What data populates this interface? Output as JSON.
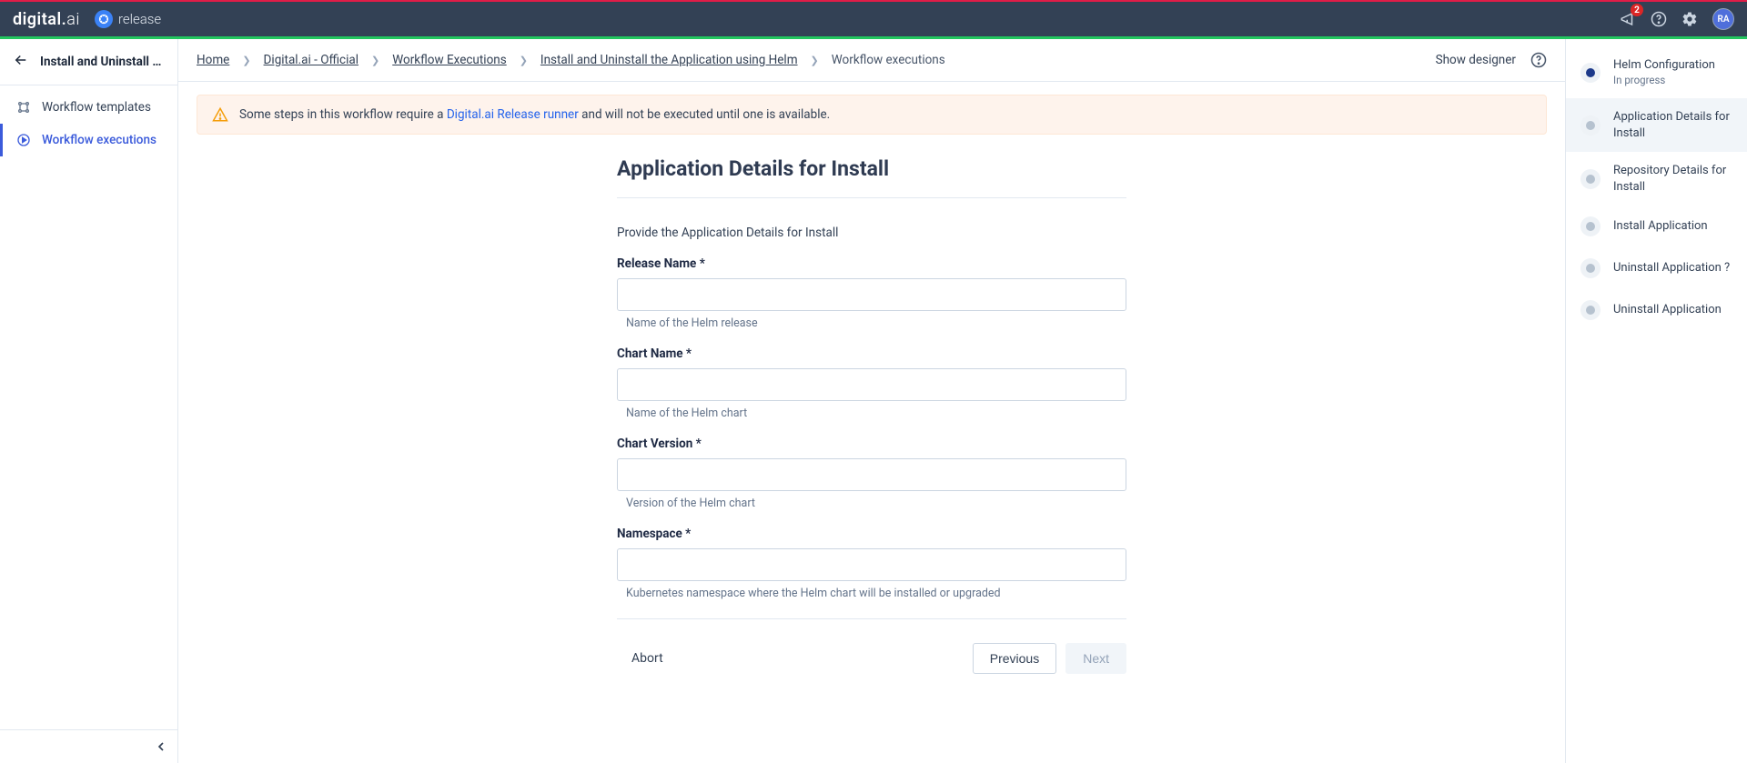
{
  "topbar": {
    "brand": "digital.ai",
    "product": "release",
    "notif_count": "2",
    "avatar": "RA"
  },
  "sidebar": {
    "title": "Install and Uninstall th…",
    "items": [
      {
        "label": "Workflow templates"
      },
      {
        "label": "Workflow executions"
      }
    ]
  },
  "breadcrumb": {
    "items": [
      "Home",
      "Digital.ai - Official",
      "Workflow Executions",
      "Install and Uninstall the Application using Helm",
      "Workflow executions"
    ],
    "show_designer": "Show designer"
  },
  "alert": {
    "prefix": "Some steps in this workflow require a ",
    "link": "Digital.ai Release runner",
    "suffix": " and will not be executed until one is available."
  },
  "form": {
    "title": "Application Details for Install",
    "description": "Provide the Application Details for Install",
    "fields": [
      {
        "label": "Release Name *",
        "help": "Name of the Helm release"
      },
      {
        "label": "Chart Name *",
        "help": "Name of the Helm chart"
      },
      {
        "label": "Chart Version *",
        "help": "Version of the Helm chart"
      },
      {
        "label": "Namespace *",
        "help": "Kubernetes namespace where the Helm chart will be installed or upgraded"
      }
    ],
    "abort": "Abort",
    "previous": "Previous",
    "next": "Next"
  },
  "steps": [
    {
      "label": "Helm Configuration",
      "sub": "In progress",
      "state": "done"
    },
    {
      "label": "Application Details for Install",
      "state": "active"
    },
    {
      "label": "Repository Details for Install"
    },
    {
      "label": "Install Application"
    },
    {
      "label": "Uninstall Application ?"
    },
    {
      "label": "Uninstall Application"
    }
  ]
}
